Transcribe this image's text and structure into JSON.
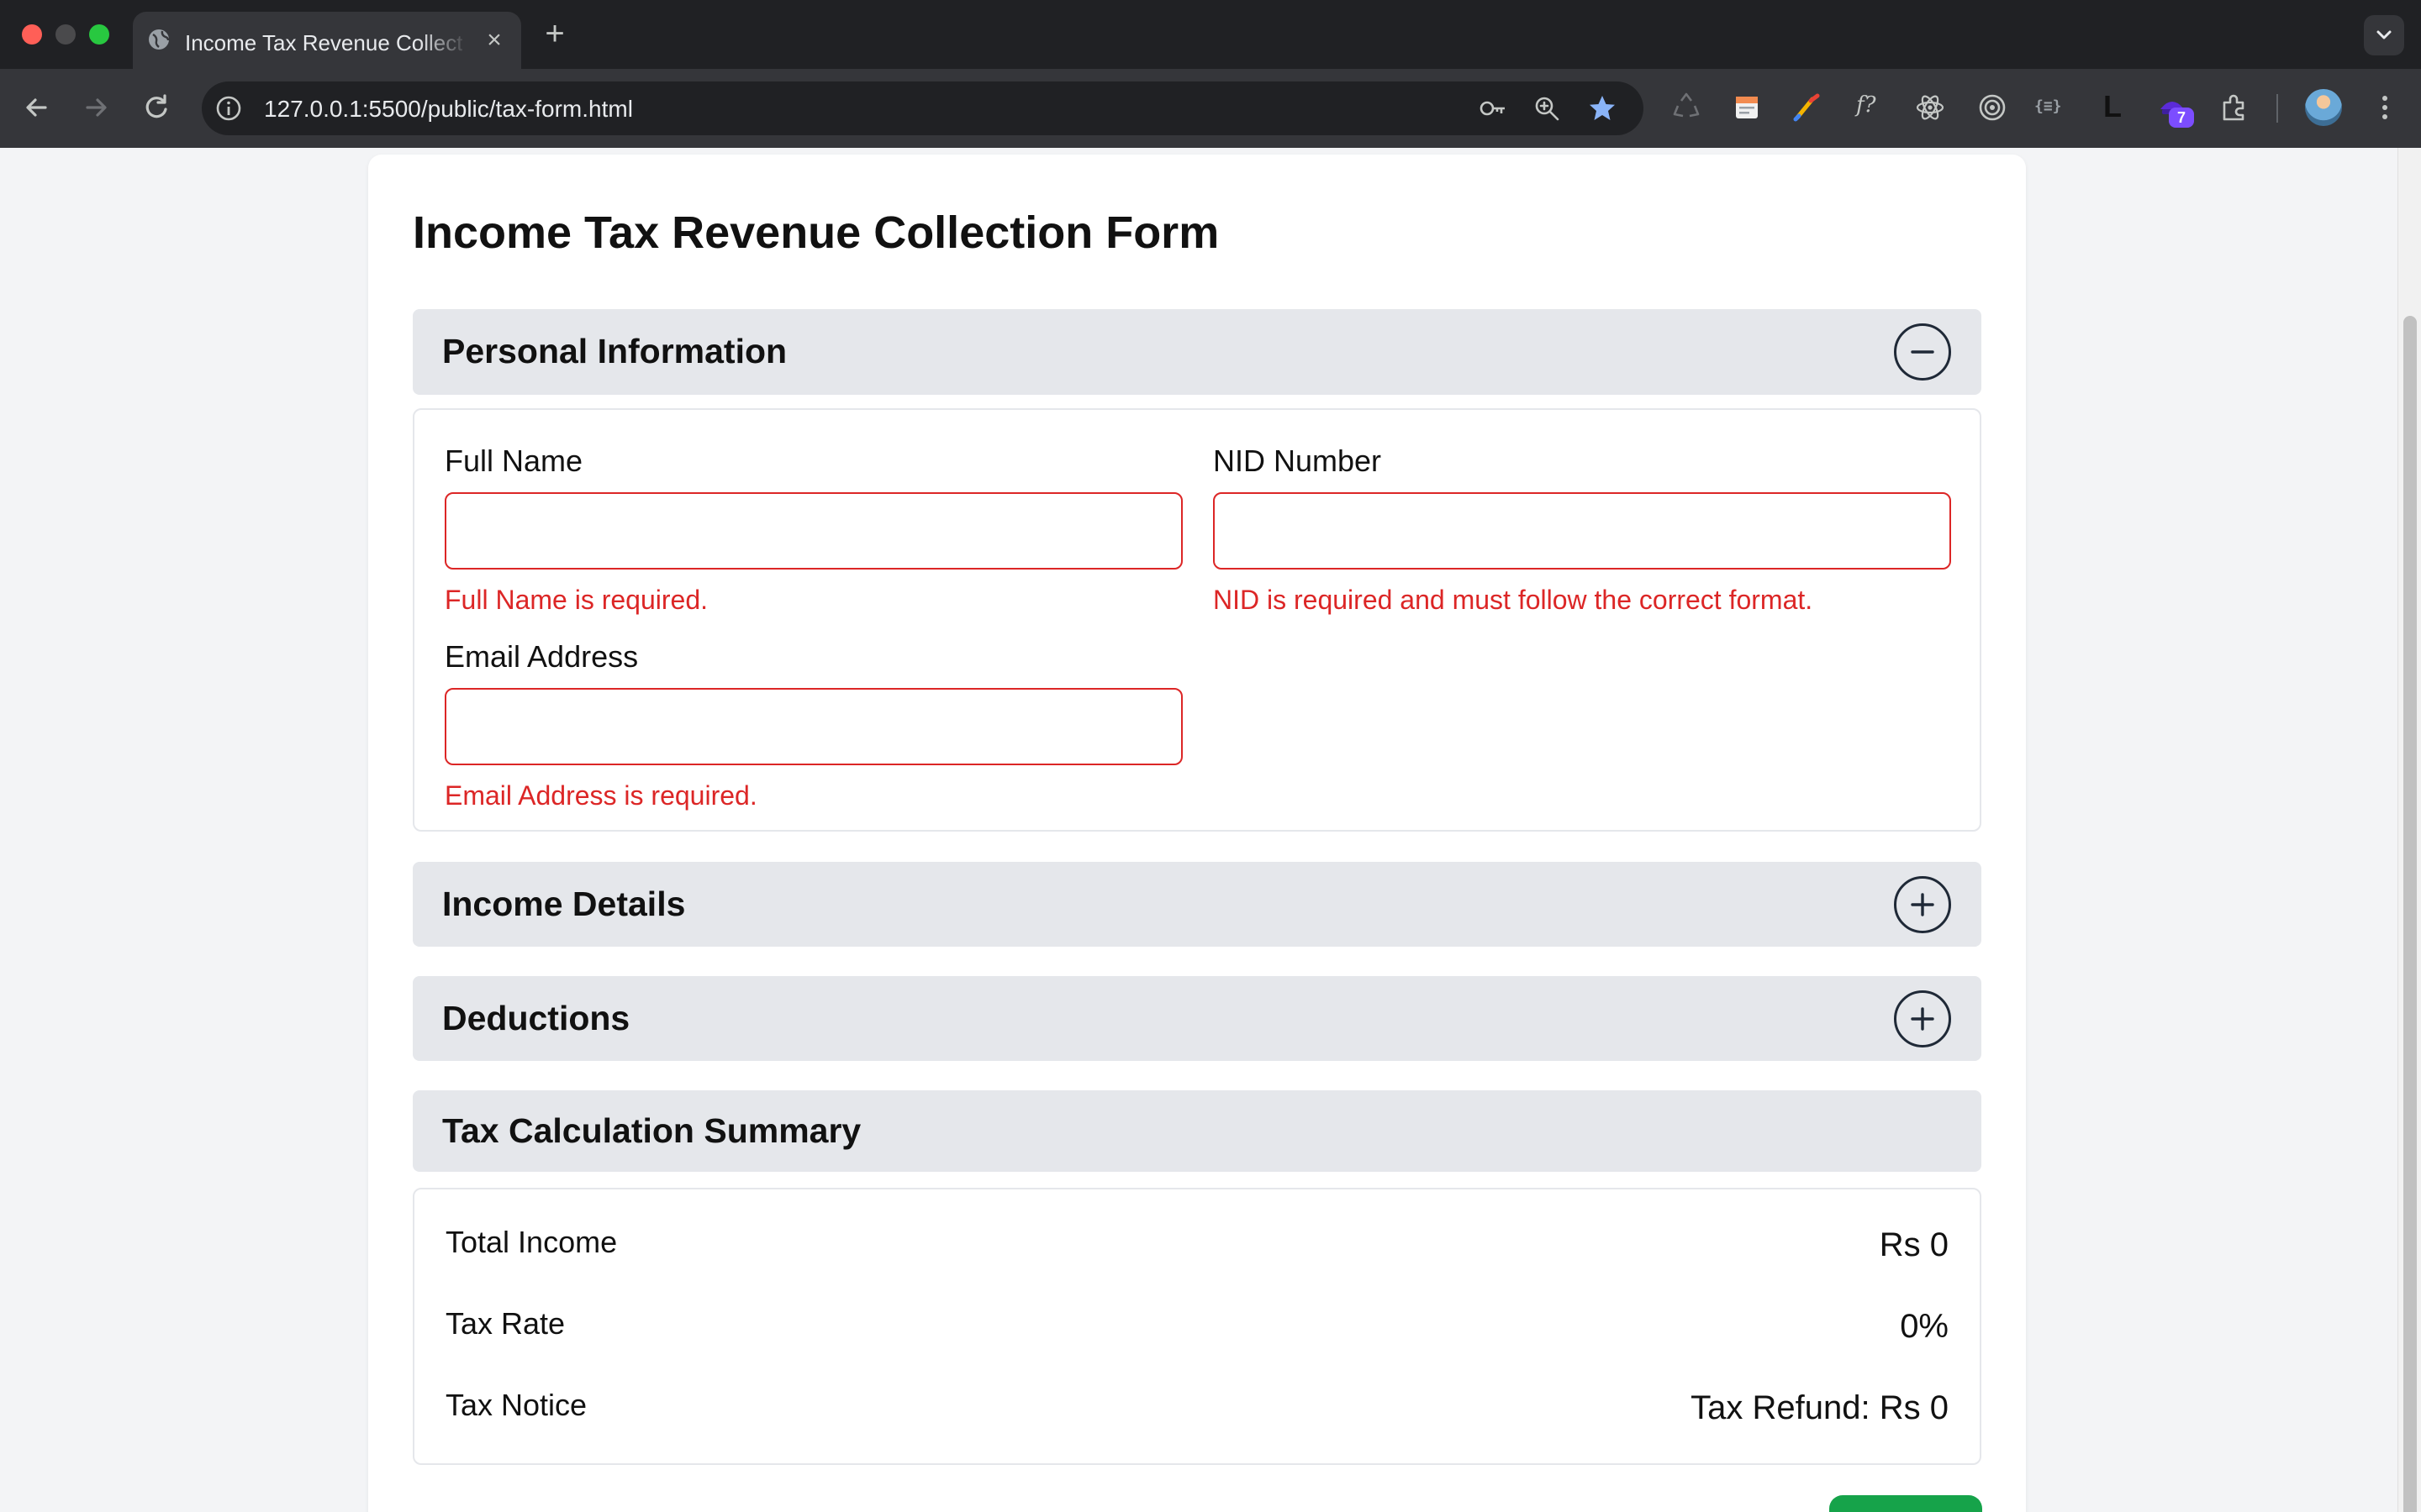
{
  "browser": {
    "tab_title": "Income Tax Revenue Collection Form",
    "url": "127.0.0.1:5500/public/tax-form.html",
    "extension_badge_count": "7",
    "extension_text_icons": [
      "f?",
      "{≡}",
      "L"
    ]
  },
  "form": {
    "title": "Income Tax Revenue Collection Form",
    "sections": {
      "personal": {
        "title": "Personal Information",
        "expanded": true,
        "fields": {
          "full_name": {
            "label": "Full Name",
            "value": "",
            "error": "Full Name is required."
          },
          "nid": {
            "label": "NID Number",
            "value": "",
            "error": "NID is required and must follow the correct format."
          },
          "email": {
            "label": "Email Address",
            "value": "",
            "error": "Email Address is required."
          }
        }
      },
      "income": {
        "title": "Income Details",
        "expanded": false
      },
      "deductions": {
        "title": "Deductions",
        "expanded": false
      },
      "summary": {
        "title": "Tax Calculation Summary",
        "rows": {
          "total_income": {
            "label": "Total Income",
            "value": "Rs 0"
          },
          "tax_rate": {
            "label": "Tax Rate",
            "value": "0%"
          },
          "tax_notice": {
            "label": "Tax Notice",
            "value": "Tax Refund: Rs 0"
          }
        }
      }
    }
  },
  "colors": {
    "error": "#dc2626",
    "section_header_bg": "#e5e7eb",
    "submit_button": "#16a34a",
    "page_bg": "#f3f4f6",
    "bookmark_star": "#8ab4f8"
  },
  "icons": {
    "collapse": "minus-circle-icon",
    "expand": "plus-circle-icon"
  }
}
